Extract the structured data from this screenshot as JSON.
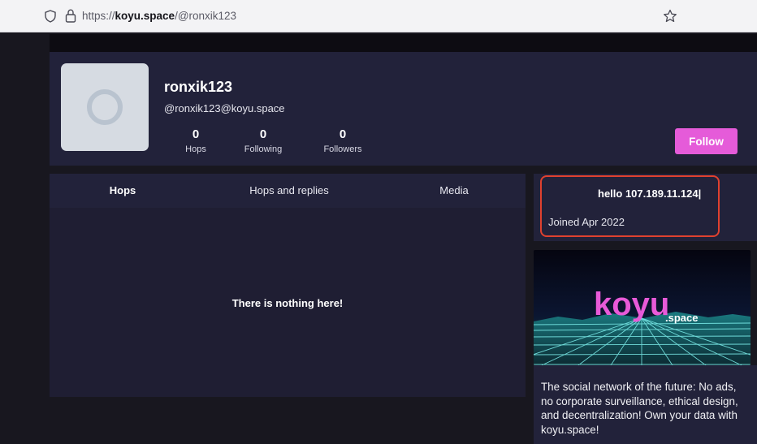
{
  "browser": {
    "url_prefix": "https://",
    "url_domain": "koyu.space",
    "url_path": "/@ronxik123"
  },
  "profile": {
    "display_name": "ronxik123",
    "handle": "@ronxik123@koyu.space",
    "stats": [
      {
        "value": "0",
        "label": "Hops"
      },
      {
        "value": "0",
        "label": "Following"
      },
      {
        "value": "0",
        "label": "Followers"
      }
    ],
    "follow_label": "Follow",
    "follow_color": "#e55bd9"
  },
  "tabs": [
    {
      "label": "Hops",
      "active": true
    },
    {
      "label": "Hops and replies",
      "active": false
    },
    {
      "label": "Media",
      "active": false
    }
  ],
  "timeline": {
    "empty_text": "There is nothing here!"
  },
  "bio": {
    "note": "hello 107.189.11.124|",
    "joined": "Joined Apr 2022"
  },
  "banner": {
    "logo_main": "koyu",
    "logo_sub": ".space"
  },
  "about": {
    "text": "The social network of the future: No ads, no corporate surveillance, ethical design, and decentralization! Own your data with koyu.space!"
  },
  "colors": {
    "accent": "#e55bd9",
    "highlight_box": "#e0412f",
    "panel": "#22223a"
  }
}
